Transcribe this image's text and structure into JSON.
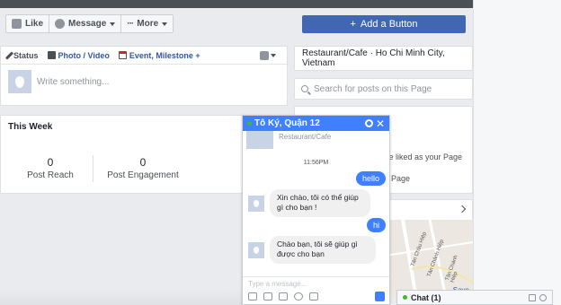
{
  "actions": {
    "like": "Like",
    "message": "Message",
    "more": "More",
    "add_button": "Add a Button",
    "add_plus": "+"
  },
  "composer": {
    "tabs": [
      "Status",
      "Photo / Video",
      "Event, Milestone +"
    ],
    "placeholder": "Write something..."
  },
  "this_week": {
    "title": "This Week",
    "post_reach_value": "0",
    "post_reach_label": "Post Reach",
    "post_engagement_value": "0",
    "post_engagement_label": "Post Engagement"
  },
  "sidebar": {
    "category": "Restaurant/Cafe · Ho Chi Minh City, Vietnam",
    "search_placeholder": "Search for posts on this Page",
    "liked_text": "ve liked as your Page",
    "this_page_text": "s Page",
    "save_text": "Save",
    "map_streets": [
      "Tân Châu Hiệp",
      "Tân Chánh Hiệp",
      "Tân Chánh Hiệp"
    ]
  },
  "chat": {
    "title": "Tô Ký, Quận 12",
    "subtitle": "Restaurant/Cafe",
    "time": "11:56PM",
    "messages": [
      {
        "from": "me",
        "text": "hello"
      },
      {
        "from": "page",
        "text": "Xin chào, tôi có thể giúp gì cho bạn !"
      },
      {
        "from": "me",
        "text": "hi"
      },
      {
        "from": "page",
        "text": "Chào bạn, tôi sẽ giúp gì được cho bạn"
      }
    ],
    "input_placeholder": "Type a message..."
  },
  "chat_bar": {
    "label": "Chat (1)"
  },
  "colors": {
    "facebook_blue": "#4267b2",
    "messenger_blue": "#4080ff",
    "online_green": "#42b72a"
  }
}
